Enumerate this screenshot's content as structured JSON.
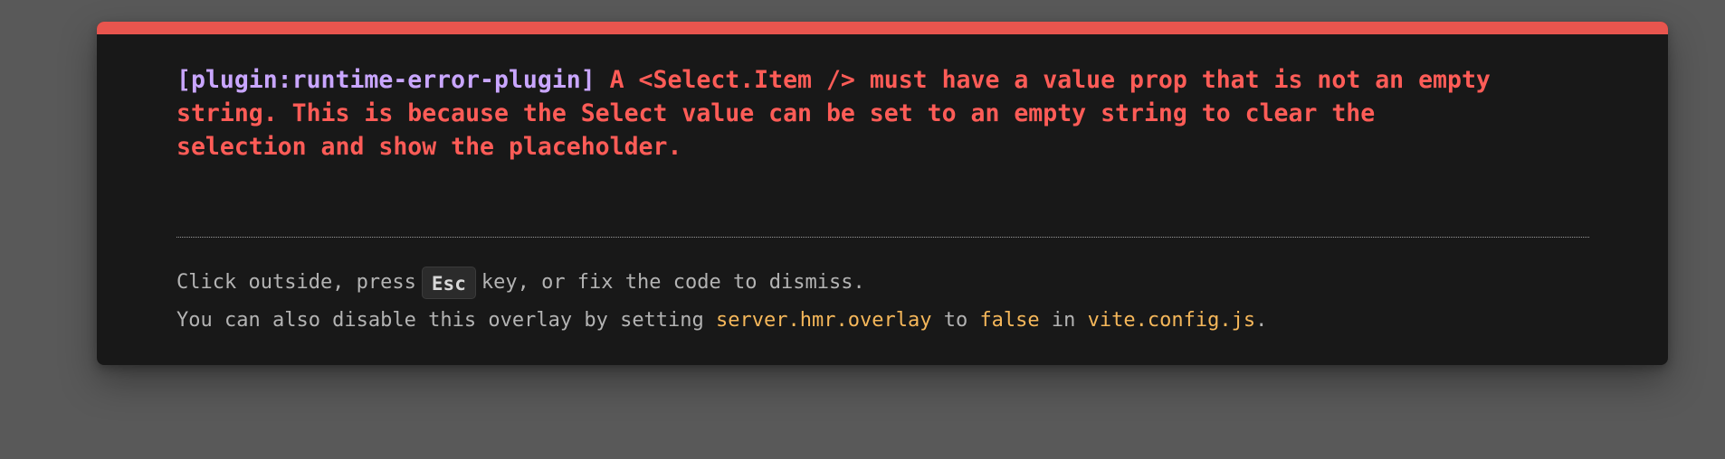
{
  "overlay": {
    "accent_color": "#e8554e",
    "plugin_color": "#c9a6ff",
    "message_color": "#ff5c57",
    "code_color": "#f5b75a",
    "plugin": "[plugin:runtime-error-plugin]",
    "message": " A <Select.Item /> must have a value prop that is not an empty\nstring. This is because the Select value can be set to an empty string to clear the\nselection and show the placeholder."
  },
  "tip": {
    "line1_before": "Click outside, press",
    "key": "Esc",
    "line1_after": "key, or fix the code to dismiss.",
    "line2_prefix": "You can also disable this overlay by setting ",
    "config_option": "server.hmr.overlay",
    "line2_mid1": " to ",
    "config_value": "false",
    "line2_mid2": " in ",
    "config_file": "vite.config.js",
    "line2_end": "."
  }
}
